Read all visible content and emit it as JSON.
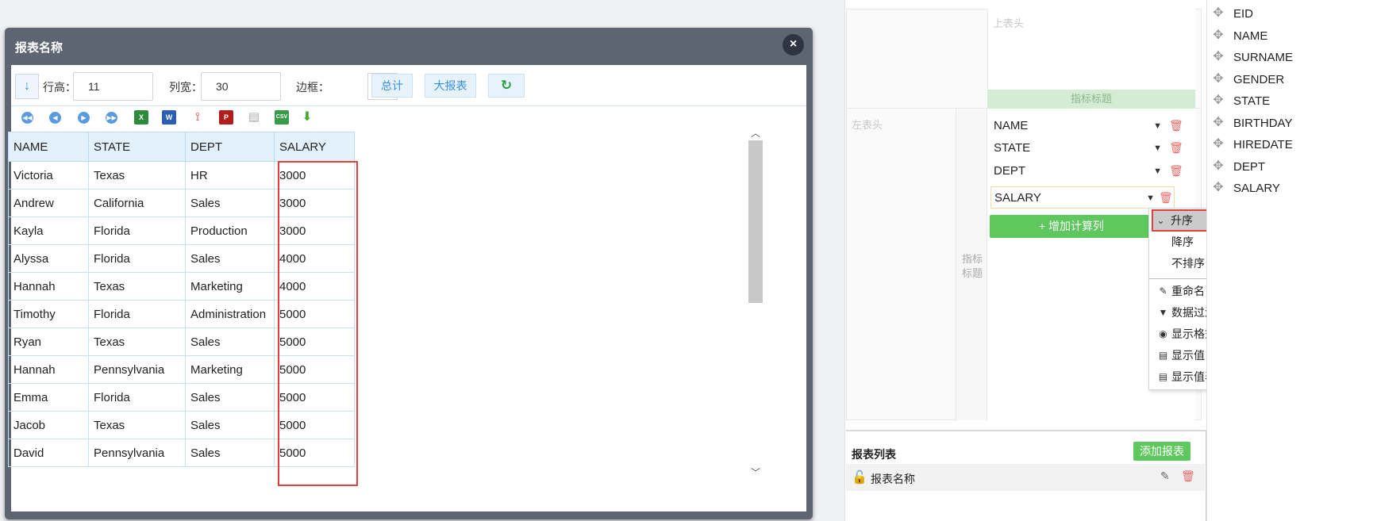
{
  "dialog": {
    "title": "报表名称",
    "close_glyph": "×",
    "toolbar": {
      "sort_glyph": "↓",
      "row_height_label": "行高：",
      "row_height_value": "11",
      "col_width_label": "列宽：",
      "col_width_value": "30",
      "border_label": "边框：",
      "border_glyph": "⌄",
      "total_label": "总计",
      "big_report_label": "大报表",
      "refresh_glyph": "↻"
    },
    "table": {
      "headers": [
        "NAME",
        "STATE",
        "DEPT",
        "SALARY"
      ],
      "rows": [
        [
          "Victoria",
          "Texas",
          "HR",
          "3000"
        ],
        [
          "Andrew",
          "California",
          "Sales",
          "3000"
        ],
        [
          "Kayla",
          "Florida",
          "Production",
          "3000"
        ],
        [
          "Alyssa",
          "Florida",
          "Sales",
          "4000"
        ],
        [
          "Hannah",
          "Texas",
          "Marketing",
          "4000"
        ],
        [
          "Timothy",
          "Florida",
          "Administration",
          "5000"
        ],
        [
          "Ryan",
          "Texas",
          "Sales",
          "5000"
        ],
        [
          "Hannah",
          "Pennsylvania",
          "Marketing",
          "5000"
        ],
        [
          "Emma",
          "Florida",
          "Sales",
          "5000"
        ],
        [
          "Jacob",
          "Texas",
          "Sales",
          "5000"
        ],
        [
          "David",
          "Pennsylvania",
          "Sales",
          "5000"
        ]
      ]
    }
  },
  "designer": {
    "top_header_placeholder": "上表头",
    "metric_title_bar": "指标标题",
    "left_header_placeholder": "左表头",
    "metric_title_vertical": "指标\n标题",
    "metric_fields": [
      "NAME",
      "STATE",
      "DEPT",
      "SALARY"
    ],
    "add_computed_column": "+ 增加计算列"
  },
  "context_menu": {
    "items": [
      "升序",
      "降序",
      "不排序",
      "重命名",
      "数据过滤",
      "显示格式",
      "显示值",
      "显示值表达式"
    ],
    "selected": "升序"
  },
  "report_list": {
    "title": "报表列表",
    "add_button": "添加报表",
    "rows": [
      {
        "name": "报表名称"
      }
    ]
  },
  "field_list": [
    "EID",
    "NAME",
    "SURNAME",
    "GENDER",
    "STATE",
    "BIRTHDAY",
    "HIREDATE",
    "DEPT",
    "SALARY"
  ],
  "colors": {
    "accent_blue": "#3a8ee6",
    "green": "#5ec75e",
    "highlight_red": "#e63d3d",
    "dialog_header": "#5d6472"
  }
}
